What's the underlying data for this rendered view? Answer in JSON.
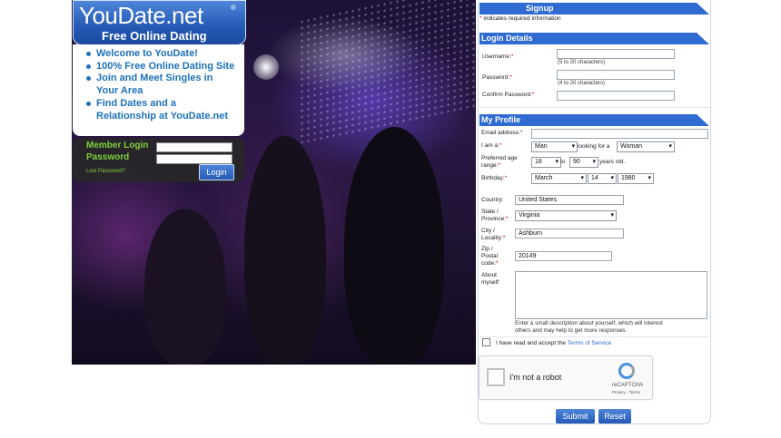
{
  "logo": {
    "title": "YouDate.net",
    "reg": "®",
    "subtitle": "Free Online Dating"
  },
  "intro": {
    "items": [
      "Welcome to YouDate!",
      "100% Free Online Dating Site",
      "Join and Meet Singles in Your Area",
      "Find Dates and a Relationship at YouDate.net"
    ]
  },
  "login": {
    "member_login": "Member Login",
    "password": "Password",
    "lost_password": "Lost Password?",
    "button": "Login"
  },
  "signup": {
    "title": "Signup",
    "required_note": "indicates required information",
    "login_details": {
      "heading": "Login Details",
      "username_label": "Username:",
      "username_hint": "(5 to 20 characters)",
      "password_label": "Password:",
      "password_hint": "(4 to 20 characters)",
      "confirm_label": "Confirm Password:"
    },
    "profile": {
      "heading": "My Profile",
      "email_label": "Email address:",
      "iam_label": "I am a:",
      "iam_value": "Man",
      "looking_for": "looking for a",
      "seeking_value": "Woman",
      "age_label_1": "Preferred age",
      "age_label_2": "range:",
      "age_from": "18",
      "age_to_word": "to",
      "age_to": "90",
      "years_old": "years old.",
      "birthday_label": "Birthday:",
      "birth_month": "March",
      "birth_day": "14",
      "birth_year": "1980",
      "country_label": "Country:",
      "country_value": "United States",
      "state_label_1": "State /",
      "state_label_2": "Province:",
      "state_value": "Virginia",
      "city_label_1": "City /",
      "city_label_2": "Locality:",
      "city_value": "Ashburn",
      "zip_label_1": "Zip /",
      "zip_label_2": "Postal",
      "zip_label_3": "code:",
      "zip_value": "20149",
      "about_label_1": "About",
      "about_label_2": "myself:",
      "about_hint_1": "Enter a small description about yourself, which will interest",
      "about_hint_2": "others and may help to get more responses."
    },
    "terms_prefix": "I have read and accept the",
    "terms_link": "Terms of Service",
    "captcha": {
      "label": "I'm not a robot",
      "brand": "reCAPTCHA",
      "links": "Privacy - Terms"
    },
    "submit": "Submit",
    "reset": "Reset"
  },
  "colors": {
    "accent": "#2f6bd0",
    "green": "#7fd13b",
    "intro_text": "#1e72b8",
    "required": "#d00000"
  }
}
